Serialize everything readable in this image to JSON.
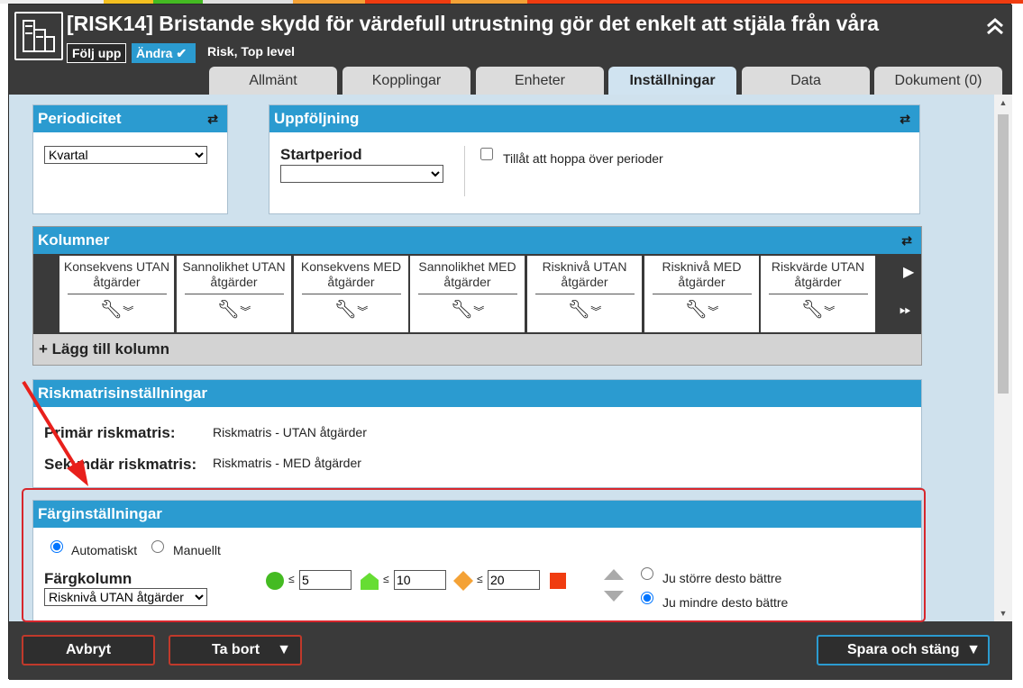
{
  "colors": {
    "accent": "#2b9bd0",
    "dark": "#3a3a3a",
    "content_bg": "#cfe1ed",
    "highlight": "#d7262c",
    "green": "#44bb22",
    "lightgreen": "#66dd33",
    "orange": "#f4a236",
    "red": "#f03c10"
  },
  "header": {
    "title": "[RISK14] Bristande skydd för värdefull utrustning gör det enkelt att stjäla från våra",
    "follow_label": "Följ upp",
    "change_label": "Ändra",
    "subtitle": "Risk, Top level"
  },
  "tabs": [
    {
      "label": "Allmänt",
      "active": false
    },
    {
      "label": "Kopplingar",
      "active": false
    },
    {
      "label": "Enheter",
      "active": false
    },
    {
      "label": "Inställningar",
      "active": true
    },
    {
      "label": "Data",
      "active": false
    },
    {
      "label": "Dokument (0)",
      "active": false
    }
  ],
  "periodicitet": {
    "title": "Periodicitet",
    "value": "Kvartal"
  },
  "uppfoljning": {
    "title": "Uppföljning",
    "start_label": "Startperiod",
    "start_value": "",
    "checkbox_label": "Tillåt att hoppa över perioder"
  },
  "kolumner": {
    "title": "Kolumner",
    "columns": [
      "Konsekvens UTAN åtgärder",
      "Sannolikhet UTAN åtgärder",
      "Konsekvens MED åtgärder",
      "Sannolikhet MED åtgärder",
      "Risknivå UTAN åtgärder",
      "Risknivå MED åtgärder",
      "Riskvärde UTAN åtgärder"
    ],
    "add_label": "+ Lägg till kolumn"
  },
  "riskmatris": {
    "title": "Riskmatrisinställningar",
    "primary_label": "Primär riskmatris:",
    "primary_value": "Riskmatris - UTAN åtgärder",
    "secondary_label": "Sekundär riskmatris:",
    "secondary_value": "Riskmatris - MED åtgärder"
  },
  "farg": {
    "title": "Färginställningar",
    "auto_label": "Automatiskt",
    "manual_label": "Manuellt",
    "column_label": "Färgkolumn",
    "column_value": "Risknivå UTAN åtgärder",
    "le": "≤",
    "t1": "5",
    "t2": "10",
    "t3": "20",
    "option_bigger": "Ju större desto bättre",
    "option_smaller": "Ju mindre desto bättre"
  },
  "footer": {
    "cancel": "Avbryt",
    "delete": "Ta bort",
    "save": "Spara och stäng"
  }
}
